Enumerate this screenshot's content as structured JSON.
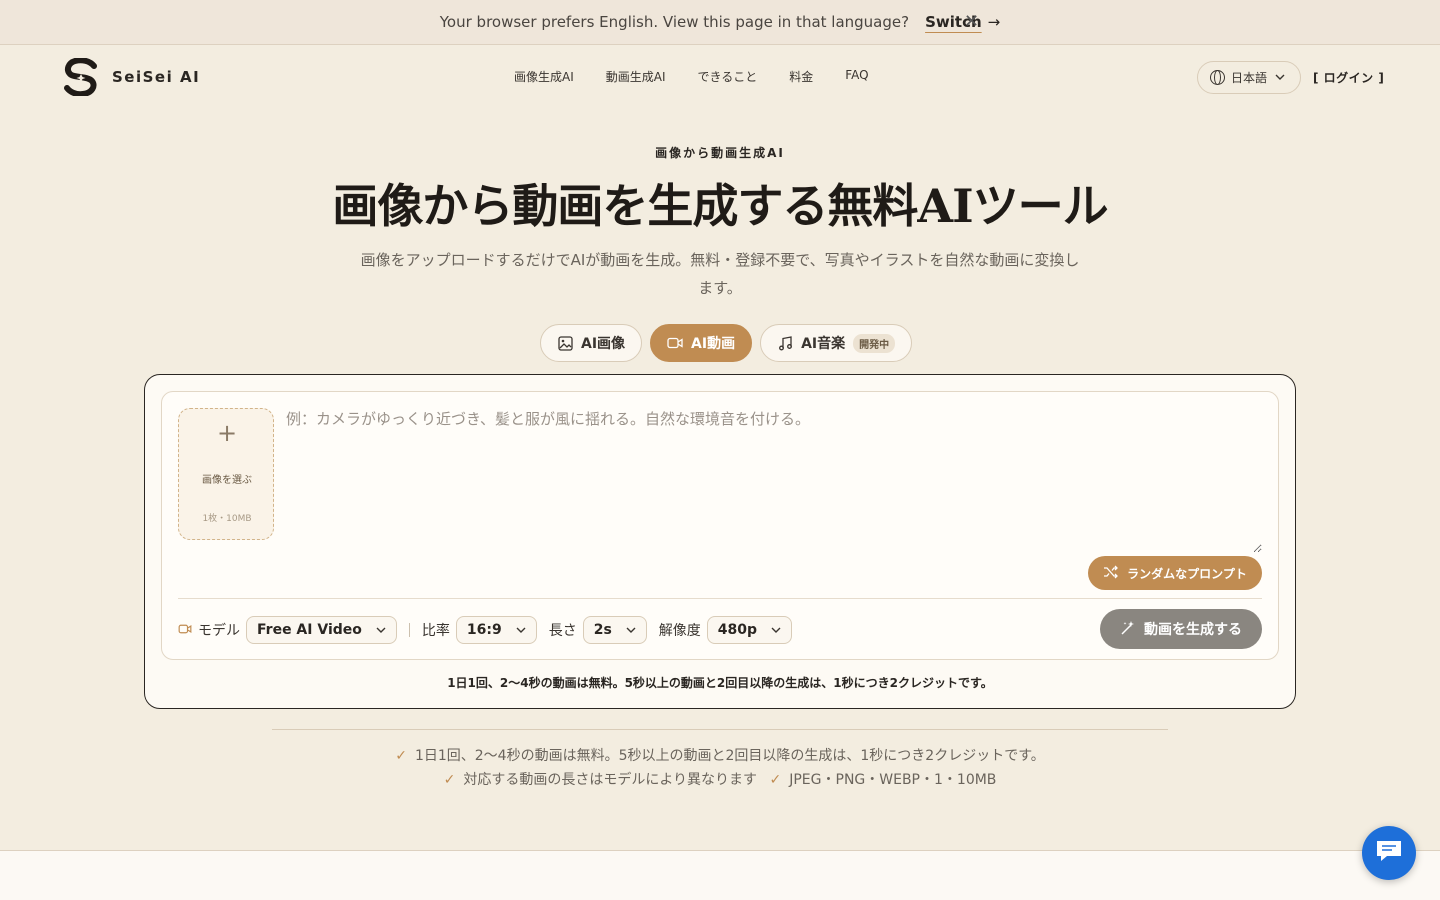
{
  "banner": {
    "message": "Your browser prefers English. View this page in that language?",
    "switch_label": "Switch",
    "arrow": "→",
    "close": "✕"
  },
  "header": {
    "brand": "SeiSei AI",
    "nav": [
      "画像生成AI",
      "動画生成AI",
      "できること",
      "料金",
      "FAQ"
    ],
    "language": "日本語",
    "login": "[ ログイン ]"
  },
  "hero": {
    "eyebrow": "画像から動画生成AI",
    "title": "画像から動画を生成する無料AIツール",
    "subtitle_line1": "画像をアップロードするだけでAIが動画を生成。無料・登録不要で、写真やイラストを自然な動画に変換し",
    "subtitle_line2": "ます。"
  },
  "tabs": [
    {
      "label": "AI画像",
      "icon": "image-icon"
    },
    {
      "label": "AI動画",
      "icon": "video-icon"
    },
    {
      "label": "AI音楽",
      "icon": "music-icon",
      "badge": "開発中"
    }
  ],
  "generator": {
    "upload_label": "画像を選ぶ",
    "upload_hint": "1枚・10MB",
    "upload_plus": "+",
    "prompt_placeholder": "例：カメラがゆっくり近づき、髪と服が風に揺れる。自然な環境音を付ける。",
    "random_button": "ランダムなプロンプト",
    "model_label": "モデル",
    "model_value": "Free AI Video",
    "ratio_label": "比率",
    "ratio_value": "16:9",
    "length_label": "長さ",
    "length_value": "2s",
    "resolution_label": "解像度",
    "resolution_value": "480p",
    "generate_button": "動画を生成する",
    "note": "1日1回、2〜4秒の動画は無料。5秒以上の動画と2回目以降の生成は、1秒につき2クレジットです。"
  },
  "notes": {
    "line1": "1日1回、2〜4秒の動画は無料。5秒以上の動画と2回目以降の生成は、1秒につき2クレジットです。",
    "line2a": "対応する動画の長さはモデルにより異なります",
    "line2b": "JPEG・PNG・WEBP・1・10MB"
  },
  "colors": {
    "accent": "#c08c52",
    "background": "#f3ede0",
    "chat": "#1e6fd9"
  }
}
